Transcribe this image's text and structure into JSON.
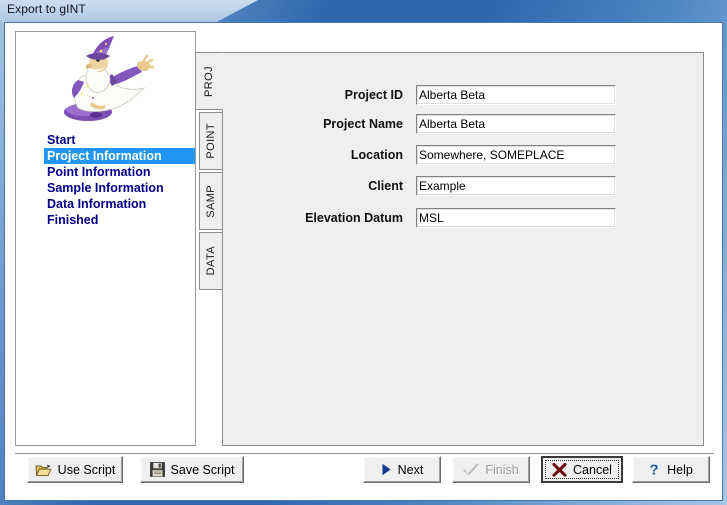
{
  "window": {
    "title": "Export to gINT"
  },
  "nav": {
    "art_name": "wizard-mascot",
    "steps": [
      {
        "label": "Start",
        "active": false
      },
      {
        "label": "Project Information",
        "active": true
      },
      {
        "label": "Point Information",
        "active": false
      },
      {
        "label": "Sample Information",
        "active": false
      },
      {
        "label": "Data Information",
        "active": false
      },
      {
        "label": "Finished",
        "active": false
      }
    ]
  },
  "tabs": [
    {
      "label": "PROJ",
      "active": true
    },
    {
      "label": "POINT",
      "active": false
    },
    {
      "label": "SAMP",
      "active": false
    },
    {
      "label": "DATA",
      "active": false
    }
  ],
  "form": {
    "fields": [
      {
        "label": "Project ID",
        "value": "Alberta Beta",
        "placeholder": ""
      },
      {
        "label": "Project Name",
        "value": "Alberta Beta",
        "placeholder": ""
      },
      {
        "label": "Location",
        "value": "Somewhere, SOMEPLACE",
        "placeholder": ""
      },
      {
        "label": "Client",
        "value": "Example",
        "placeholder": ""
      },
      {
        "label": "Elevation Datum",
        "value": "MSL",
        "placeholder": ""
      }
    ]
  },
  "buttons": {
    "use_script": {
      "label": "Use Script",
      "icon": "folder-open-icon",
      "enabled": true
    },
    "save_script": {
      "label": "Save Script",
      "icon": "floppy-disk-icon",
      "enabled": true
    },
    "next": {
      "label": "Next",
      "icon": "play-triangle-icon",
      "enabled": true
    },
    "finish": {
      "label": "Finish",
      "icon": "check-icon",
      "enabled": false
    },
    "cancel": {
      "label": "Cancel",
      "icon": "x-mark-icon",
      "enabled": true,
      "default": true
    },
    "help": {
      "label": "Help",
      "icon": "question-mark-icon",
      "enabled": true
    }
  },
  "colors": {
    "titlebar_blue": "#2f68ae",
    "selection_blue": "#2196f3",
    "step_text": "#00008b",
    "panel_grey": "#efefef",
    "cancel_x": "#6e0b14",
    "help_blue": "#1b5e9e",
    "next_arrow": "#123a8f"
  }
}
